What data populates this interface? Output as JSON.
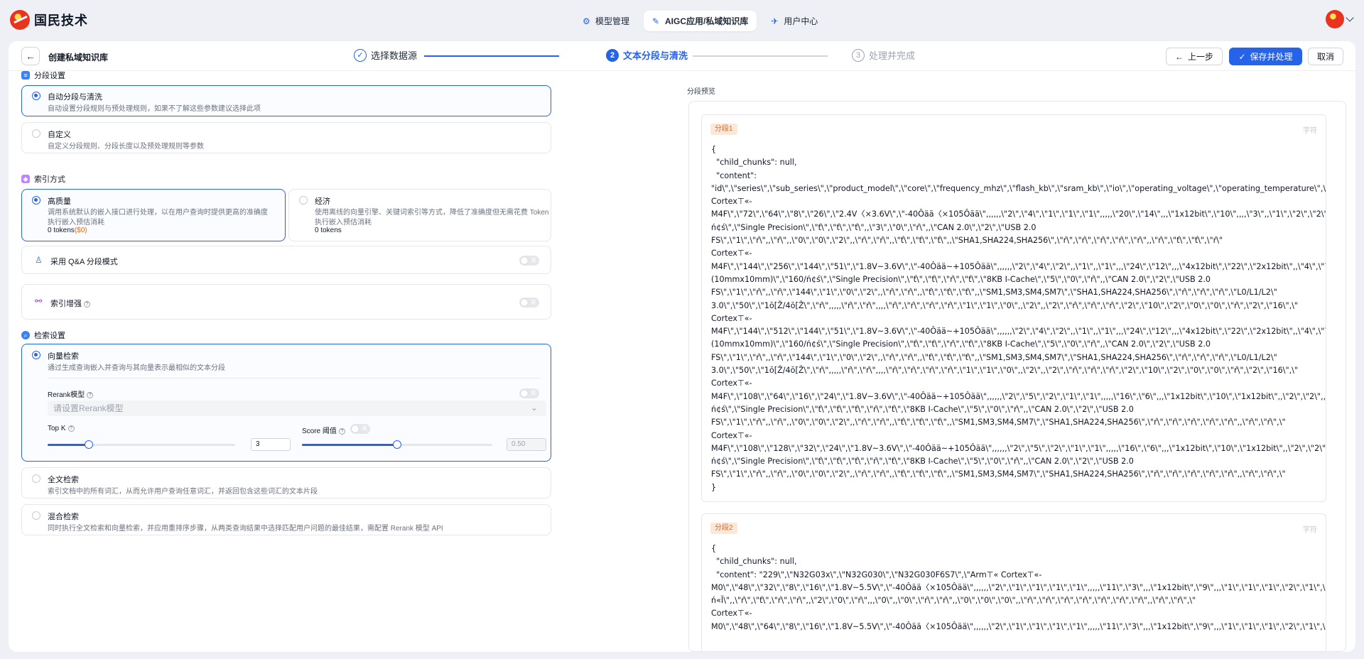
{
  "brand": {
    "name": "国民技术"
  },
  "nav": {
    "tabs": [
      {
        "label": "模型管理",
        "icon": "model-icon",
        "active": false
      },
      {
        "label": "AIGC应用/私域知识库",
        "icon": "knowledge-icon",
        "active": true
      },
      {
        "label": "用户中心",
        "icon": "user-center-icon",
        "active": false
      }
    ]
  },
  "header": {
    "back_icon": "←",
    "title": "创建私域知识库",
    "steps": [
      {
        "num": "✓",
        "label": "选择数据源",
        "state": "done"
      },
      {
        "num": "2",
        "label": "文本分段与清洗",
        "state": "current"
      },
      {
        "num": "3",
        "label": "处理并完成",
        "state": "todo"
      }
    ],
    "prev_label": "上一步",
    "save_label": "保存并处理",
    "cancel_label": "取消"
  },
  "segment": {
    "section_title": "分段设置",
    "auto": {
      "title": "自动分段与清洗",
      "desc": "自动设置分段规则与预处理规则，如果不了解这些参数建议选择此项"
    },
    "custom": {
      "title": "自定义",
      "desc": "自定义分段规则、分段长度以及预处理规则等参数"
    }
  },
  "index": {
    "section_title": "索引方式",
    "high": {
      "title": "高质量",
      "desc1": "调用系统默认的嵌入接口进行处理，以在用户查询时提供更高的准确度",
      "desc2": "执行嵌入预估消耗",
      "tokens": "0 tokens",
      "cost": "($0)"
    },
    "economy": {
      "title": "经济",
      "desc1": "使用离线的向量引擎、关键词索引等方式，降低了准确度但无需花费 Token",
      "desc2": "执行嵌入预估消耗",
      "tokens": "0 tokens"
    },
    "qa_label": "采用 Q&A 分段模式",
    "enhance_label": "索引增强",
    "help_icon": "?"
  },
  "retrieval": {
    "section_title": "检索设置",
    "vector": {
      "title": "向量检索",
      "desc": "通过生成查询嵌入并查询与其向量表示最相似的文本分段"
    },
    "rerank_label": "Rerank模型",
    "rerank_placeholder": "请设置Rerank模型",
    "topk_label": "Top K",
    "topk_value": "3",
    "topk_fraction": 0.22,
    "score_label": "Score 阈值",
    "score_value": "0.50",
    "score_fraction": 0.5,
    "toggle_off": "关",
    "fulltext": {
      "title": "全文检索",
      "desc": "索引文档中的所有词汇，从而允许用户查询任意词汇，并返回包含这些词汇的文本片段"
    },
    "hybrid": {
      "title": "混合检索",
      "desc": "同时执行全文检索和向量检索，并应用重排序步骤，从两类查询结果中选择匹配用户问题的最佳结果，需配置 Rerank 模型 API"
    }
  },
  "preview": {
    "title": "分段预览",
    "chars_label": "字符",
    "chunks": [
      {
        "badge": "分段1",
        "lines": [
          "{",
          "  \"child_chunks\": null,",
          "  \"content\":",
          "\"id\\\",\\\"series\\\",\\\"sub_series\\\",\\\"product_model\\\",\\\"core\\\",\\\"frequency_mhz\\\",\\\"flash_kb\\\",\\\"sram_kb\\\",\\\"io\\\",\\\"operating_voltage\\\",\\\"operating_temperature\\\",\\\"dc",
          "Cortex⊤«-",
          "M4F\\\",\\\"72\\\",\\\"64\\\",\\\"8\\\",\\\"26\\\",\\\"2.4V〈×3.6V\\\",\\\"-40Ôää〈×105Ôää\\\",,,,,,\\\"2\\\",\\\"4\\\",\\\"1\\\",\\\"1\\\",\\\"1\\\",,,,,\\\"20\\\",\\\"14\\\",,,\\\"1x12bit\\\",\\\"10\\\",,,,\\\"3\\\",,\\\"1\\\",\\\"2\\\",\\\"2\\\",,\\\"",
          "ń¢ś\\\",\\\"Single Precision\\\",\\\"ť\\\",\\\"ť\\\",\\\"ť\\\",,\\\"3\\\",\\\"0\\\",\\\"ŕ\\\",,\\\"CAN 2.0\\\",\\\"2\\\",\\\"USB 2.0",
          "FS\\\",\\\"1\\\",\\\"ŕ\\\",,\\\"ŕ\\\",,\\\"0\\\",\\\"0\\\",\\\"2\\\",,\\\"ŕ\\\",\\\"ŕ\\\",,\\\"ť\\\",\\\"ť\\\",\\\"ť\\\",,\\\"SHA1,SHA224,SHA256\\\",\\\"ŕ\\\",\\\"ŕ\\\",\\\"ŕ\\\",\\\"ŕ\\\",\\\"ŕ\\\",,\\\"ŕ\\\",\\\"ť\\\",\\\"ť\\\",\\\"ŕ\\\"",
          "Cortex⊤«-",
          "M4F\\\",\\\"144\\\",\\\"256\\\",\\\"144\\\",\\\"51\\\",\\\"1.8V~3.6V\\\",\\\"-40Ôää~+105Ôää\\\",,,,,,\\\"2\\\",\\\"4\\\",\\\"2\\\",,\\\"1\\\",,\\\"1\\\",,,\\\"24\\\",\\\"12\\\",,,\\\"4x12bit\\\",\\\"22\\\",\\\"2x12bit\\\",,\\\"4\\\",\\\"7\\\",,\\\"",
          "(10mmx10mm)\\\",\\\"160/ń¢ś\\\",\\\"Single Precision\\\",\\\"ť\\\",\\\"ť\\\",\\\"ŕ\\\",\\\"ť\\\",\\\"8KB I-Cache\\\",\\\"5\\\",\\\"0\\\",\\\"ŕ\\\",,\\\"CAN 2.0\\\",\\\"2\\\",\\\"USB 2.0",
          "FS\\\",\\\"1\\\",\\\"ŕ\\\",,\\\"ŕ\\\",\\\"144\\\",\\\"1\\\",\\\"0\\\",\\\"2\\\",,\\\"ŕ\\\",\\\"ŕ\\\",,\\\"ť\\\",\\\"ť\\\",\\\"ť\\\",,\\\"SM1,SM3,SM4,SM7\\\",\\\"SHA1,SHA224,SHA256\\\",\\\"ŕ\\\",\\\"ŕ\\\",\\\"ŕ\\\",\\\"L0/L1/L2\\\"",
          "3.0\\\",\\\"50\\\",\\\"1ŏ[Ž/4ŏ[Ž\\\",\\\"ŕ\\\",,,,,\\\"ŕ\\\",\\\"ŕ\\\",,,,\\\"ŕ\\\",\\\"ŕ\\\",\\\"ŕ\\\",\\\"ŕ\\\",\\\"1\\\",\\\"1\\\",\\\"0\\\",,\\\"2\\\",,\\\"2\\\",\\\"ŕ\\\",\\\"ŕ\\\",\\\"ŕ\\\",\\\"2\\\",\\\"10\\\",\\\"2\\\",\\\"0\\\",\\\"0\\\",\\\"ŕ\\\",\\\"2\\\",\\\"16\\\",\\\"",
          "Cortex⊤«-",
          "M4F\\\",\\\"144\\\",\\\"512\\\",\\\"144\\\",\\\"51\\\",\\\"1.8V~3.6V\\\",\\\"-40Ôää~+105Ôää\\\",,,,,,\\\"2\\\",\\\"4\\\",\\\"2\\\",,\\\"1\\\",,\\\"1\\\",,,\\\"24\\\",\\\"12\\\",,,\\\"4x12bit\\\",\\\"22\\\",\\\"2x12bit\\\",,\\\"4\\\",\\\"7\\\",,\\\"",
          "(10mmx10mm)\\\",\\\"160/ń¢ś\\\",\\\"Single Precision\\\",\\\"ť\\\",\\\"ť\\\",\\\"ŕ\\\",\\\"ť\\\",\\\"8KB I-Cache\\\",\\\"5\\\",\\\"0\\\",\\\"ŕ\\\",,\\\"CAN 2.0\\\",\\\"2\\\",\\\"USB 2.0",
          "FS\\\",\\\"1\\\",\\\"ŕ\\\",,\\\"ŕ\\\",\\\"144\\\",\\\"1\\\",\\\"0\\\",\\\"2\\\",,\\\"ŕ\\\",\\\"ŕ\\\",,\\\"ť\\\",\\\"ť\\\",\\\"ť\\\",,\\\"SM1,SM3,SM4,SM7\\\",\\\"SHA1,SHA224,SHA256\\\",\\\"ŕ\\\",\\\"ŕ\\\",\\\"ŕ\\\",\\\"L0/L1/L2\\\"",
          "3.0\\\",\\\"50\\\",\\\"1ŏ[Ž/4ŏ[Ž\\\",\\\"ŕ\\\",,,,,\\\"ŕ\\\",\\\"ŕ\\\",,,,\\\"ŕ\\\",\\\"ŕ\\\",\\\"ŕ\\\",\\\"ŕ\\\",\\\"1\\\",\\\"1\\\",\\\"0\\\",,\\\"2\\\",,\\\"2\\\",\\\"ŕ\\\",\\\"ŕ\\\",\\\"ŕ\\\",\\\"2\\\",\\\"10\\\",\\\"2\\\",\\\"0\\\",\\\"0\\\",\\\"ŕ\\\",\\\"2\\\",\\\"16\\\",\\\"",
          "Cortex⊤«-",
          "M4F\\\",\\\"108\\\",\\\"64\\\",\\\"16\\\",\\\"24\\\",\\\"1.8V~3.6V\\\",\\\"-40Ôää~+105Ôää\\\",,,,,,\\\"2\\\",\\\"5\\\",\\\"2\\\",\\\"1\\\",\\\"1\\\",,,,,\\\"16\\\",\\\"6\\\",,,\\\"1x12bit\\\",\\\"10\\\",\\\"1x12bit\\\",,\\\"2\\\",\\\"2\\\",,\\\"2\\\"",
          "ń¢ś\\\",\\\"Single Precision\\\",\\\"ť\\\",\\\"ť\\\",\\\"ť\\\",\\\"ŕ\\\",\\\"ť\\\",\\\"8KB I-Cache\\\",\\\"5\\\",\\\"0\\\",\\\"ŕ\\\",,\\\"CAN 2.0\\\",\\\"2\\\",\\\"USB 2.0",
          "FS\\\",\\\"1\\\",\\\"ŕ\\\",,\\\"ŕ\\\",,\\\"0\\\",\\\"0\\\",\\\"2\\\",,\\\"ŕ\\\",\\\"ŕ\\\",,\\\"ť\\\",\\\"ť\\\",\\\"ť\\\",,\\\"SM1,SM3,SM4,SM7\\\",\\\"SHA1,SHA224,SHA256\\\",\\\"ŕ\\\",\\\"ŕ\\\",\\\"ŕ\\\",\\\"ŕ\\\",\\\"ŕ\\\",,\\\"ŕ\\\",\\\"ŕ\\\",\\\"",
          "Cortex⊤«-",
          "M4F\\\",\\\"108\\\",\\\"128\\\",\\\"32\\\",\\\"24\\\",\\\"1.8V~3.6V\\\",\\\"-40Ôää~+105Ôää\\\",,,,,,\\\"2\\\",\\\"5\\\",\\\"2\\\",\\\"1\\\",\\\"1\\\",,,,,\\\"16\\\",\\\"6\\\",,,\\\"1x12bit\\\",\\\"10\\\",\\\"1x12bit\\\",,\\\"2\\\",\\\"2\\\",,\\\"2\\\"",
          "ń¢ś\\\",\\\"Single Precision\\\",\\\"ť\\\",\\\"ť\\\",\\\"ť\\\",\\\"ŕ\\\",\\\"ť\\\",\\\"8KB I-Cache\\\",\\\"5\\\",\\\"0\\\",\\\"ŕ\\\",,\\\"CAN 2.0\\\",\\\"2\\\",\\\"USB 2.0",
          "FS\\\",\\\"1\\\",\\\"ŕ\\\",,\\\"ŕ\\\",,\\\"0\\\",\\\"0\\\",\\\"2\\\",,\\\"ŕ\\\",\\\"ŕ\\\",,\\\"ť\\\",\\\"ť\\\",\\\"ť\\\",,\\\"SM1,SM3,SM4,SM7\\\",\\\"SHA1,SHA224,SHA256\\\",\\\"ŕ\\\",\\\"ŕ\\\",\\\"ŕ\\\",\\\"ŕ\\\",\\\"ŕ\\\",,\\\"ŕ\\\",\\\"ŕ\\\",\\\"",
          "}"
        ]
      },
      {
        "badge": "分段2",
        "lines": [
          "{",
          "  \"child_chunks\": null,",
          "  \"content\": \"229\\\",\\\"N32G03x\\\",\\\"N32G030\\\",\\\"N32G030F6S7\\\",\\\"Arm⊤« Cortex⊤«-",
          "M0\\\",\\\"48\\\",\\\"32\\\",\\\"8\\\",\\\"16\\\",\\\"1.8V~5.5V\\\",\\\"-40Ôää〈×105Ôää\\\",,,,,,\\\"2\\\",\\\"1\\\",\\\"1\\\",\\\"1\\\",\\\"1\\\",,,,,\\\"11\\\",\\\"3\\\",,,\\\"1x12bit\\\",\\\"9\\\",,,\\\"1\\\",\\\"1\\\",\\\"1\\\",\\\"2\\\",\\\"1\\\",\\\"2\\\"",
          "ń«Ĩ\\\",,\\\"ŕ\\\",\\\"ť\\\",\\\"ŕ\\\",\\\"ŕ\\\",,\\\"2\\\",\\\"0\\\",\\\"ŕ\\\",,,\\\"0\\\",,\\\"0\\\",\\\"ŕ\\\",\\\"ŕ\\\",,\\\"0\\\",\\\"0\\\",\\\"0\\\",,\\\"ŕ\\\",\\\"ŕ\\\",\\\"ŕ\\\",\\\"ŕ\\\",\\\"ŕ\\\",\\\"ŕ\\\",\\\"ŕ\\\",,\\\"ŕ\\\",\\\"ŕ\\\",\\\"",
          "Cortex⊤«-",
          "M0\\\",\\\"48\\\",\\\"64\\\",\\\"8\\\",\\\"16\\\",\\\"1.8V~5.5V\\\",\\\"-40Ôää〈×105Ôää\\\",,,,,,\\\"2\\\",\\\"1\\\",\\\"1\\\",\\\"1\\\",\\\"1\\\",,,,,\\\"11\\\",\\\"3\\\",,,\\\"1x12bit\\\",\\\"9\\\",,,\\\"1\\\",\\\"1\\\",\\\"1\\\",\\\"2\\\",\\\"1\\\",\\\"2\\\""
        ]
      }
    ]
  },
  "colors": {
    "accent": "#2563eb",
    "badge_bg": "#fde8d8",
    "badge_fg": "#e4671f"
  }
}
